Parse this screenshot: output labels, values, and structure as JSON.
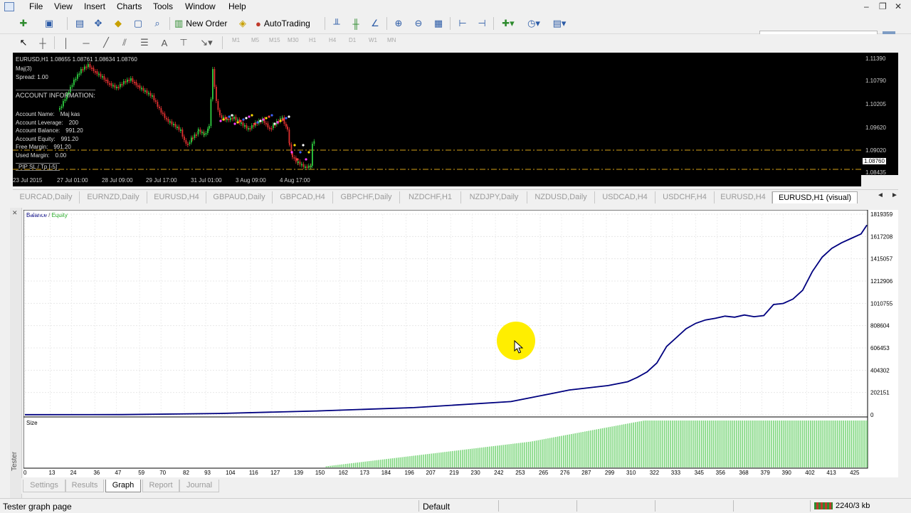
{
  "menu": {
    "items": [
      "File",
      "View",
      "Insert",
      "Charts",
      "Tools",
      "Window",
      "Help"
    ]
  },
  "toolbar": {
    "new_order_label": "New Order",
    "autotrading_label": "AutoTrading",
    "timeframes": [
      "M1",
      "M5",
      "M15",
      "M30",
      "H1",
      "H4",
      "D1",
      "W1",
      "MN"
    ]
  },
  "chart": {
    "header": "EURUSD,H1  1.08655 1.08761 1.08634 1.08760",
    "ea_name": "Maj(3)",
    "spread": "Spread: 1.00",
    "account_title": "ACCOUNT INFORMATION:",
    "account_rows": [
      {
        "label": "Account Name:",
        "value": "Maj kas"
      },
      {
        "label": "Account Leverage:",
        "value": "200"
      },
      {
        "label": "Account Balance:",
        "value": "991.20"
      },
      {
        "label": "Account Equity:",
        "value": "991.20"
      },
      {
        "label": "Free Margin:",
        "value": "991.20"
      },
      {
        "label": "Used Margin:",
        "value": "0.00"
      }
    ],
    "bottom_text": "PIP  SL / Tp  [-5]",
    "price_labels": [
      "1.11390",
      "1.10790",
      "1.10205",
      "1.09620",
      "1.09020",
      "1.08760",
      "1.08435"
    ],
    "time_labels": [
      "23 Jul 2015",
      "27 Jul 01:00",
      "28 Jul 09:00",
      "29 Jul 17:00",
      "31 Jul 01:00",
      "3 Aug 09:00",
      "4 Aug 17:00"
    ]
  },
  "chart_tabs": [
    "EURCAD,Daily",
    "EURNZD,Daily",
    "EURUSD,H4",
    "GBPAUD,Daily",
    "GBPCAD,H4",
    "GBPCHF,Daily",
    "NZDCHF,H1",
    "NZDJPY,Daily",
    "NZDUSD,Daily",
    "USDCAD,H4",
    "USDCHF,H4",
    "EURUSD,H4",
    "EURUSD,H1 (visual)"
  ],
  "chart_data": {
    "type": "line",
    "series": [
      {
        "name": "Balance",
        "color": "#000080"
      },
      {
        "name": "Equity",
        "color": "#22aa22"
      }
    ],
    "legend_balance": "Balance",
    "legend_sep": " / ",
    "legend_equity": "Equity",
    "y_tick_labels": [
      "1819359",
      "1617208",
      "1415057",
      "1212906",
      "1010755",
      "808604",
      "606453",
      "404302",
      "202151",
      "0"
    ],
    "x_tick_labels": [
      "0",
      "13",
      "24",
      "36",
      "47",
      "59",
      "70",
      "82",
      "93",
      "104",
      "116",
      "127",
      "139",
      "150",
      "162",
      "173",
      "184",
      "196",
      "207",
      "219",
      "230",
      "242",
      "253",
      "265",
      "276",
      "287",
      "299",
      "310",
      "322",
      "333",
      "345",
      "356",
      "368",
      "379",
      "390",
      "402",
      "413",
      "425"
    ],
    "size_label": "Size",
    "x": [
      0,
      50,
      100,
      150,
      200,
      250,
      260,
      270,
      280,
      290,
      300,
      310,
      315,
      320,
      325,
      330,
      335,
      340,
      345,
      350,
      355,
      360,
      365,
      370,
      375,
      380,
      385,
      390,
      395,
      400,
      405,
      410,
      415,
      420,
      425,
      430,
      433
    ],
    "balance": [
      991,
      2000,
      12000,
      35000,
      65000,
      120000,
      155000,
      190000,
      225000,
      245000,
      265000,
      300000,
      340000,
      390000,
      470000,
      620000,
      700000,
      780000,
      830000,
      860000,
      875000,
      895000,
      885000,
      905000,
      890000,
      900000,
      1000000,
      1010000,
      1050000,
      1130000,
      1300000,
      1430000,
      1510000,
      1560000,
      1600000,
      1640000,
      1720000
    ],
    "ylim": [
      0,
      1819359
    ]
  },
  "tester_tabs": [
    "Settings",
    "Results",
    "Graph",
    "Report",
    "Journal"
  ],
  "tester_side_label": "Tester",
  "status": {
    "hint": "Tester graph page",
    "profile": "Default",
    "traffic": "2240/3 kb"
  }
}
